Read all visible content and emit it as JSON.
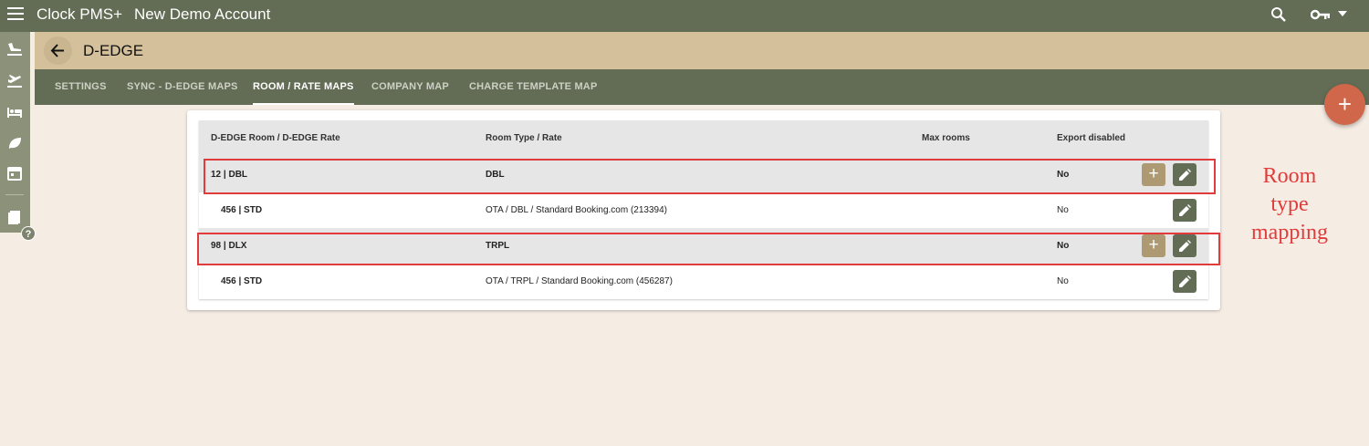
{
  "topbar": {
    "app_title": "Clock PMS+",
    "account_title": "New Demo Account",
    "icons": [
      "menu-icon",
      "search-icon",
      "key-icon",
      "caret-down-icon"
    ]
  },
  "rail": {
    "icons": [
      "plane-arrival-icon",
      "plane-departure-icon",
      "bed-icon",
      "leaf-icon",
      "calendar-icon",
      "book-icon"
    ],
    "help_label": "?"
  },
  "header": {
    "title": "D-EDGE"
  },
  "tabs": [
    {
      "label": "SETTINGS",
      "active": false
    },
    {
      "label": "SYNC - D-EDGE MAPS",
      "active": false
    },
    {
      "label": "ROOM / RATE MAPS",
      "active": true
    },
    {
      "label": "COMPANY MAP",
      "active": false
    },
    {
      "label": "CHARGE TEMPLATE MAP",
      "active": false
    }
  ],
  "fab": {
    "label": "+"
  },
  "table": {
    "columns": [
      "D-EDGE Room / D-EDGE Rate",
      "Room Type / Rate",
      "Max rooms",
      "Export disabled"
    ],
    "rows": [
      {
        "kind": "parent",
        "code": "12 | DBL",
        "type": "DBL",
        "max": "",
        "export_disabled": "No",
        "add_label": "+"
      },
      {
        "kind": "child",
        "code": "456 | STD",
        "type": "OTA / DBL / Standard Booking.com (213394)",
        "max": "",
        "export_disabled": "No"
      },
      {
        "kind": "parent",
        "code": "98 | DLX",
        "type": "TRPL",
        "max": "",
        "export_disabled": "No",
        "add_label": "+"
      },
      {
        "kind": "child",
        "code": "456 | STD",
        "type": "OTA / TRPL / Standard Booking.com (456287)",
        "max": "",
        "export_disabled": "No"
      }
    ]
  },
  "annotation": {
    "line1": "Room",
    "line2": "type",
    "line3": "mapping",
    "color": "#e23b3b"
  },
  "colors": {
    "topbar": "#636d55",
    "subheader": "#d4c19c",
    "background": "#f5ece3",
    "fab": "#d0674a",
    "add_button": "#ad9a72",
    "edit_button": "#636d55"
  }
}
